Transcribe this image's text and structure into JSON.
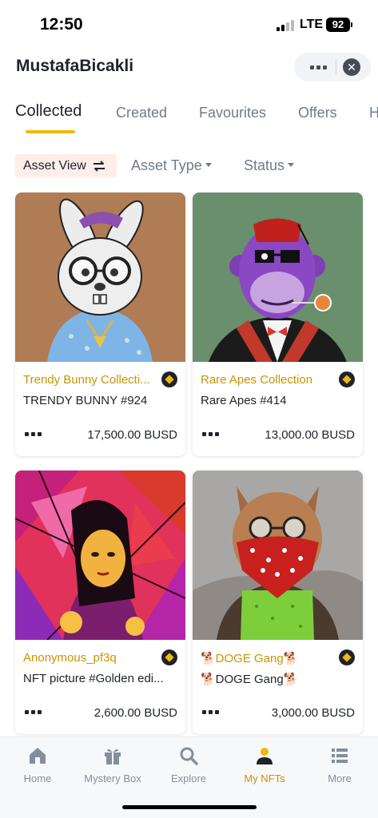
{
  "status_bar": {
    "time": "12:50",
    "network": "LTE",
    "battery": "92"
  },
  "header": {
    "title": "MustafaBicakli",
    "more_icon": "ellipsis-icon",
    "close_icon": "close-icon"
  },
  "tabs": [
    {
      "label": "Collected",
      "active": true
    },
    {
      "label": "Created",
      "active": false
    },
    {
      "label": "Favourites",
      "active": false
    },
    {
      "label": "Offers",
      "active": false
    },
    {
      "label": "H",
      "active": false
    }
  ],
  "filters": {
    "asset_view": "Asset View",
    "asset_type": "Asset Type",
    "status": "Status"
  },
  "cards": [
    {
      "collection": "Trendy Bunny Collecti...",
      "name": "TRENDY BUNNY #924",
      "price": "17,500.00 BUSD",
      "image": "bunny-nft-image",
      "bg": "#b07c55"
    },
    {
      "collection": "Rare Apes Collection",
      "name": "Rare Apes #414",
      "price": "13,000.00 BUSD",
      "image": "ape-nft-image",
      "bg": "#6a8f6c"
    },
    {
      "collection": "Anonymous_pf3q",
      "name": "NFT picture #Golden edi...",
      "price": "2,600.00 BUSD",
      "image": "portrait-nft-image",
      "bg": "#e0325a"
    },
    {
      "collection": "🐕DOGE Gang🐕",
      "name": "🐕DOGE Gang🐕",
      "price": "3,000.00 BUSD",
      "image": "doge-nft-image",
      "bg": "#a9a7a6"
    }
  ],
  "bottom_nav": [
    {
      "label": "Home",
      "icon": "home-icon",
      "active": false
    },
    {
      "label": "Mystery Box",
      "icon": "gift-box-icon",
      "active": false
    },
    {
      "label": "Explore",
      "icon": "search-icon",
      "active": false
    },
    {
      "label": "My NFTs",
      "icon": "user-icon",
      "active": true
    },
    {
      "label": "More",
      "icon": "menu-list-icon",
      "active": false
    }
  ],
  "colors": {
    "accent": "#f0b90b",
    "collection_text": "#c99400",
    "inactive_text": "#707a8a"
  }
}
